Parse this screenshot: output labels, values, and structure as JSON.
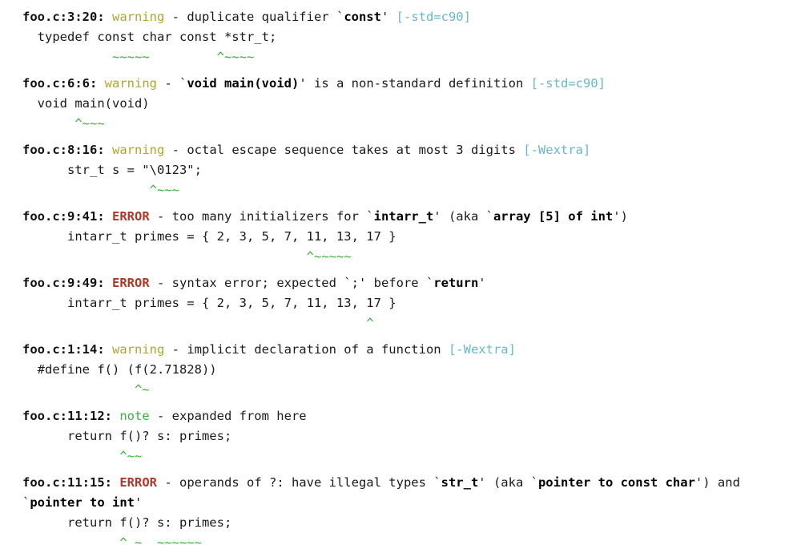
{
  "colors": {
    "background": "#ffffff",
    "text": "#1a1a1a",
    "warning": "#b0a52c",
    "error": "#b0372a",
    "note": "#3fb03f",
    "flag": "#66b9c6",
    "marker": "#35b035"
  },
  "separator": "-",
  "diagnostics": [
    {
      "location": "foo.c:3:20:",
      "severity": "warning",
      "severity_kind": "warning",
      "message_pre": " duplicate qualifier `",
      "message_code": "const",
      "message_post": "' ",
      "flag": "[-std=c90]",
      "source_line": "  typedef const char const *str_t;",
      "marker_line": "            ~~~~~         ^~~~~"
    },
    {
      "location": "foo.c:6:6:",
      "severity": "warning",
      "severity_kind": "warning",
      "message_pre": " `",
      "message_code": "void main(void)",
      "message_post": "' is a non-standard definition ",
      "flag": "[-std=c90]",
      "source_line": "  void main(void)",
      "marker_line": "       ^~~~"
    },
    {
      "location": "foo.c:8:16:",
      "severity": "warning",
      "severity_kind": "warning",
      "message_pre": " octal escape sequence takes at most 3 digits ",
      "message_code": "",
      "message_post": "",
      "flag": "[-Wextra]",
      "source_line": "      str_t s = \"\\0123\";",
      "marker_line": "                 ^~~~"
    },
    {
      "location": "foo.c:9:41:",
      "severity": "ERROR",
      "severity_kind": "error",
      "message_pre": " too many initializers for `",
      "message_code": "intarr_t",
      "message_post": "' (aka `",
      "message_code2": "array [5] of int",
      "message_post2": "')",
      "flag": "",
      "source_line": "      intarr_t primes = { 2, 3, 5, 7, 11, 13, 17 }",
      "marker_line": "                                      ^~~~~~"
    },
    {
      "location": "foo.c:9:49:",
      "severity": "ERROR",
      "severity_kind": "error",
      "message_pre": " syntax error; expected `;' before `",
      "message_code": "return",
      "message_post": "'",
      "flag": "",
      "source_line": "      intarr_t primes = { 2, 3, 5, 7, 11, 13, 17 }",
      "marker_line": "                                              ^"
    },
    {
      "location": "foo.c:1:14:",
      "severity": "warning",
      "severity_kind": "warning",
      "message_pre": " implicit declaration of a function ",
      "message_code": "",
      "message_post": "",
      "flag": "[-Wextra]",
      "source_line": "  #define f() (f(2.71828))",
      "marker_line": "               ^~"
    },
    {
      "location": "foo.c:11:12:",
      "severity": "note",
      "severity_kind": "note",
      "message_pre": " expanded from here",
      "message_code": "",
      "message_post": "",
      "flag": "",
      "source_line": "      return f()? s: primes;",
      "marker_line": "             ^~~"
    },
    {
      "location": "foo.c:11:15:",
      "severity": "ERROR",
      "severity_kind": "error",
      "message_pre": " operands of ?: have illegal types `",
      "message_code": "str_t",
      "message_post": "' (aka `",
      "message_code2": "pointer to const char",
      "message_post2": "') and `",
      "message_code3": "pointer to int",
      "message_post3": "'",
      "flag": "",
      "wrap_at": 18,
      "source_line": "      return f()? s: primes;",
      "marker_line": "             ^ ~  ~~~~~~"
    }
  ]
}
